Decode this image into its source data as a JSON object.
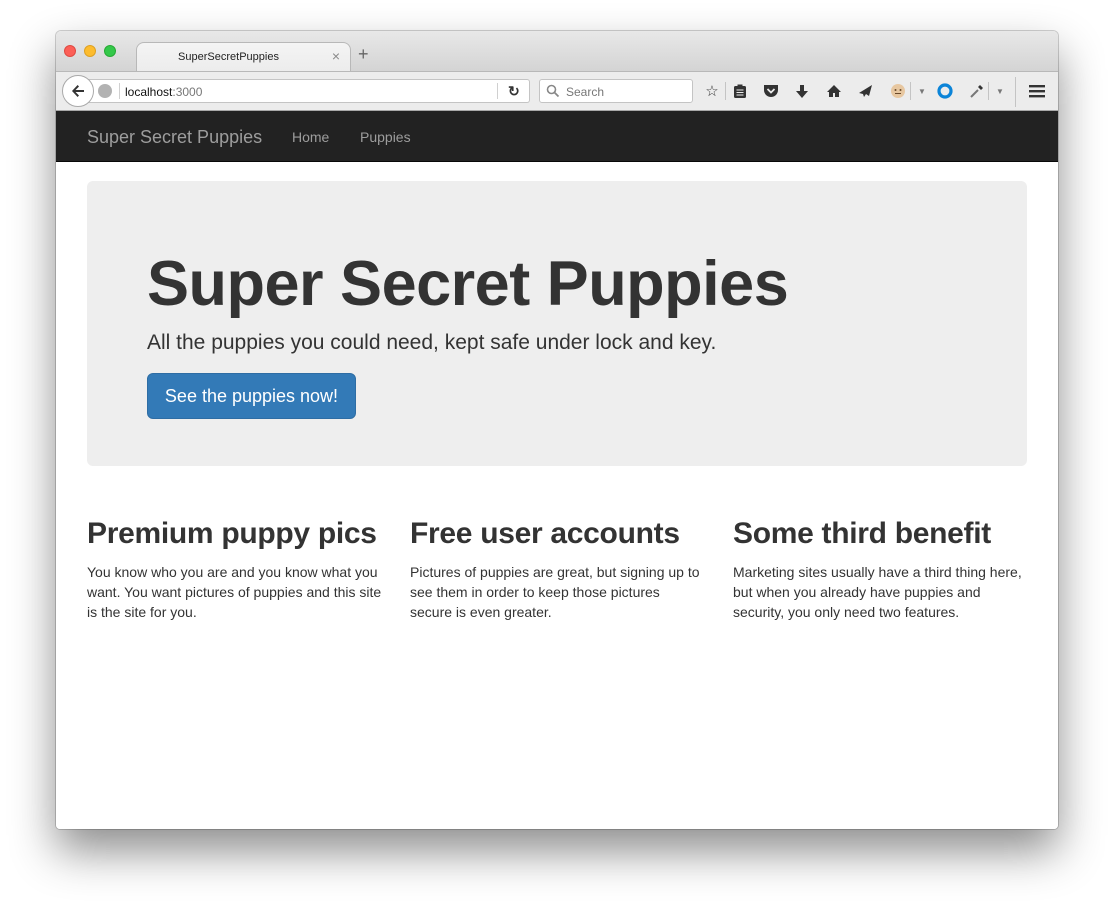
{
  "browser": {
    "tab_title": "SuperSecretPuppies",
    "tab_close_glyph": "×",
    "new_tab_glyph": "+",
    "url_host": "localhost",
    "url_port": ":3000",
    "search_placeholder": "Search",
    "reload_glyph": "↻",
    "toolbar_icons": [
      "bookmark-star-icon",
      "reading-list-icon",
      "pocket-icon",
      "download-icon",
      "home-icon",
      "send-icon",
      "addon-face-icon",
      "addon-dropdown-icon",
      "blue-ring-icon",
      "eyedropper-icon",
      "eyedropper-dropdown-icon",
      "hamburger-menu-icon"
    ]
  },
  "navbar": {
    "brand": "Super Secret Puppies",
    "links": [
      {
        "label": "Home"
      },
      {
        "label": "Puppies"
      }
    ]
  },
  "jumbotron": {
    "title": "Super Secret Puppies",
    "lead": "All the puppies you could need, kept safe under lock and key.",
    "button_label": "See the puppies now!"
  },
  "features": [
    {
      "heading": "Premium puppy pics",
      "body": "You know who you are and you know what you want. You want pictures of puppies and this site is the site for you."
    },
    {
      "heading": "Free user accounts",
      "body": "Pictures of puppies are great, but signing up to see them in order to keep those pictures secure is even greater."
    },
    {
      "heading": "Some third benefit",
      "body": "Marketing sites usually have a third thing here, but when you already have puppies and security, you only need two features."
    }
  ],
  "colors": {
    "navbar_bg": "#222222",
    "jumbotron_bg": "#eeeeee",
    "primary": "#337ab7",
    "text": "#333333"
  }
}
